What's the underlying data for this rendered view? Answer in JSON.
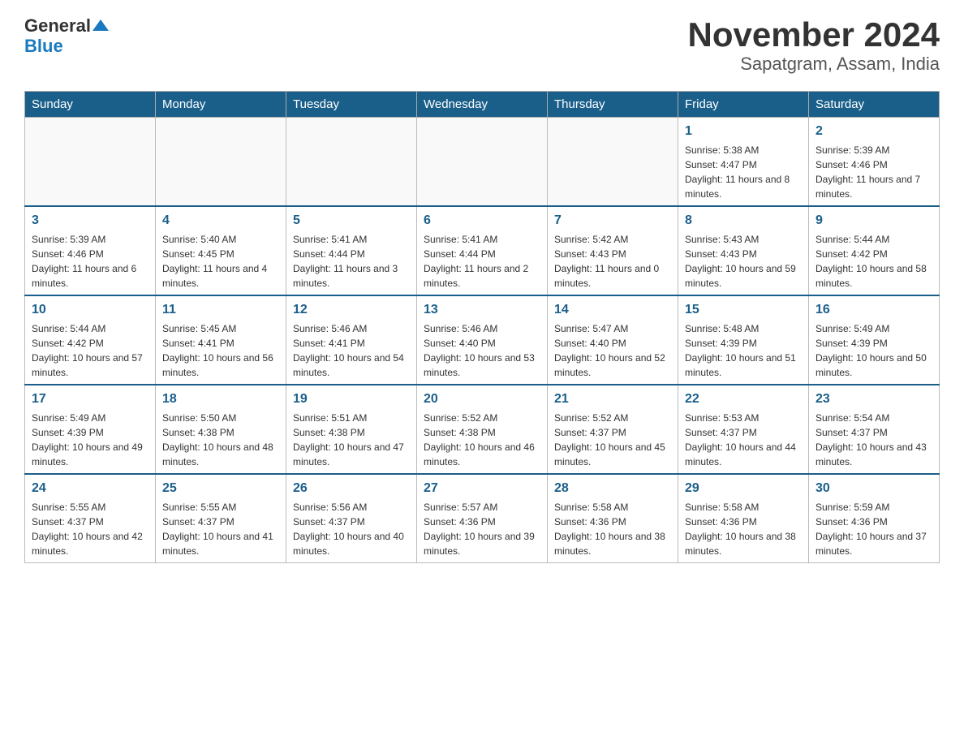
{
  "header": {
    "logo_general": "General",
    "logo_blue": "Blue",
    "month_year": "November 2024",
    "location": "Sapatgram, Assam, India"
  },
  "weekdays": [
    "Sunday",
    "Monday",
    "Tuesday",
    "Wednesday",
    "Thursday",
    "Friday",
    "Saturday"
  ],
  "weeks": [
    [
      {
        "day": "",
        "info": ""
      },
      {
        "day": "",
        "info": ""
      },
      {
        "day": "",
        "info": ""
      },
      {
        "day": "",
        "info": ""
      },
      {
        "day": "",
        "info": ""
      },
      {
        "day": "1",
        "info": "Sunrise: 5:38 AM\nSunset: 4:47 PM\nDaylight: 11 hours and 8 minutes."
      },
      {
        "day": "2",
        "info": "Sunrise: 5:39 AM\nSunset: 4:46 PM\nDaylight: 11 hours and 7 minutes."
      }
    ],
    [
      {
        "day": "3",
        "info": "Sunrise: 5:39 AM\nSunset: 4:46 PM\nDaylight: 11 hours and 6 minutes."
      },
      {
        "day": "4",
        "info": "Sunrise: 5:40 AM\nSunset: 4:45 PM\nDaylight: 11 hours and 4 minutes."
      },
      {
        "day": "5",
        "info": "Sunrise: 5:41 AM\nSunset: 4:44 PM\nDaylight: 11 hours and 3 minutes."
      },
      {
        "day": "6",
        "info": "Sunrise: 5:41 AM\nSunset: 4:44 PM\nDaylight: 11 hours and 2 minutes."
      },
      {
        "day": "7",
        "info": "Sunrise: 5:42 AM\nSunset: 4:43 PM\nDaylight: 11 hours and 0 minutes."
      },
      {
        "day": "8",
        "info": "Sunrise: 5:43 AM\nSunset: 4:43 PM\nDaylight: 10 hours and 59 minutes."
      },
      {
        "day": "9",
        "info": "Sunrise: 5:44 AM\nSunset: 4:42 PM\nDaylight: 10 hours and 58 minutes."
      }
    ],
    [
      {
        "day": "10",
        "info": "Sunrise: 5:44 AM\nSunset: 4:42 PM\nDaylight: 10 hours and 57 minutes."
      },
      {
        "day": "11",
        "info": "Sunrise: 5:45 AM\nSunset: 4:41 PM\nDaylight: 10 hours and 56 minutes."
      },
      {
        "day": "12",
        "info": "Sunrise: 5:46 AM\nSunset: 4:41 PM\nDaylight: 10 hours and 54 minutes."
      },
      {
        "day": "13",
        "info": "Sunrise: 5:46 AM\nSunset: 4:40 PM\nDaylight: 10 hours and 53 minutes."
      },
      {
        "day": "14",
        "info": "Sunrise: 5:47 AM\nSunset: 4:40 PM\nDaylight: 10 hours and 52 minutes."
      },
      {
        "day": "15",
        "info": "Sunrise: 5:48 AM\nSunset: 4:39 PM\nDaylight: 10 hours and 51 minutes."
      },
      {
        "day": "16",
        "info": "Sunrise: 5:49 AM\nSunset: 4:39 PM\nDaylight: 10 hours and 50 minutes."
      }
    ],
    [
      {
        "day": "17",
        "info": "Sunrise: 5:49 AM\nSunset: 4:39 PM\nDaylight: 10 hours and 49 minutes."
      },
      {
        "day": "18",
        "info": "Sunrise: 5:50 AM\nSunset: 4:38 PM\nDaylight: 10 hours and 48 minutes."
      },
      {
        "day": "19",
        "info": "Sunrise: 5:51 AM\nSunset: 4:38 PM\nDaylight: 10 hours and 47 minutes."
      },
      {
        "day": "20",
        "info": "Sunrise: 5:52 AM\nSunset: 4:38 PM\nDaylight: 10 hours and 46 minutes."
      },
      {
        "day": "21",
        "info": "Sunrise: 5:52 AM\nSunset: 4:37 PM\nDaylight: 10 hours and 45 minutes."
      },
      {
        "day": "22",
        "info": "Sunrise: 5:53 AM\nSunset: 4:37 PM\nDaylight: 10 hours and 44 minutes."
      },
      {
        "day": "23",
        "info": "Sunrise: 5:54 AM\nSunset: 4:37 PM\nDaylight: 10 hours and 43 minutes."
      }
    ],
    [
      {
        "day": "24",
        "info": "Sunrise: 5:55 AM\nSunset: 4:37 PM\nDaylight: 10 hours and 42 minutes."
      },
      {
        "day": "25",
        "info": "Sunrise: 5:55 AM\nSunset: 4:37 PM\nDaylight: 10 hours and 41 minutes."
      },
      {
        "day": "26",
        "info": "Sunrise: 5:56 AM\nSunset: 4:37 PM\nDaylight: 10 hours and 40 minutes."
      },
      {
        "day": "27",
        "info": "Sunrise: 5:57 AM\nSunset: 4:36 PM\nDaylight: 10 hours and 39 minutes."
      },
      {
        "day": "28",
        "info": "Sunrise: 5:58 AM\nSunset: 4:36 PM\nDaylight: 10 hours and 38 minutes."
      },
      {
        "day": "29",
        "info": "Sunrise: 5:58 AM\nSunset: 4:36 PM\nDaylight: 10 hours and 38 minutes."
      },
      {
        "day": "30",
        "info": "Sunrise: 5:59 AM\nSunset: 4:36 PM\nDaylight: 10 hours and 37 minutes."
      }
    ]
  ]
}
